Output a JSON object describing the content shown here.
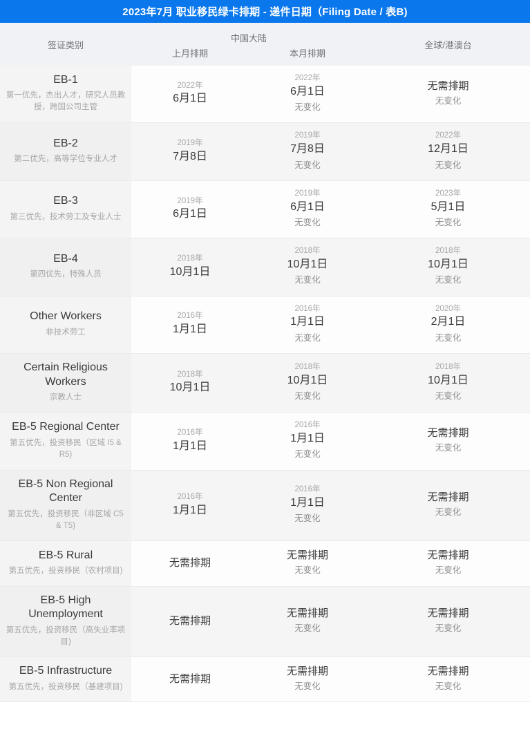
{
  "title": "2023年7月 职业移民绿卡排期 - 递件日期（Filing Date / 表B)",
  "accent_color": "#0a78ec",
  "header": {
    "category": "签证类别",
    "china_group": "中国大陆",
    "china_prev": "上月排期",
    "china_curr": "本月排期",
    "global": "全球/港澳台"
  },
  "labels": {
    "no_change": "无变化",
    "current": "无需排期"
  },
  "rows": [
    {
      "category": "EB-1",
      "description": "第一优先，杰出人才，研究人员教授，跨国公司主管",
      "china_prev": {
        "year": "2022年",
        "date": "6月1日",
        "note": ""
      },
      "china_curr": {
        "year": "2022年",
        "date": "6月1日",
        "note": "无变化"
      },
      "global": {
        "year": "",
        "date": "无需排期",
        "note": "无变化"
      }
    },
    {
      "category": "EB-2",
      "description": "第二优先，高等学位专业人才",
      "china_prev": {
        "year": "2019年",
        "date": "7月8日",
        "note": ""
      },
      "china_curr": {
        "year": "2019年",
        "date": "7月8日",
        "note": "无变化"
      },
      "global": {
        "year": "2022年",
        "date": "12月1日",
        "note": "无变化"
      }
    },
    {
      "category": "EB-3",
      "description": "第三优先，技术劳工及专业人士",
      "china_prev": {
        "year": "2019年",
        "date": "6月1日",
        "note": ""
      },
      "china_curr": {
        "year": "2019年",
        "date": "6月1日",
        "note": "无变化"
      },
      "global": {
        "year": "2023年",
        "date": "5月1日",
        "note": "无变化"
      }
    },
    {
      "category": "EB-4",
      "description": "第四优先，特殊人员",
      "china_prev": {
        "year": "2018年",
        "date": "10月1日",
        "note": ""
      },
      "china_curr": {
        "year": "2018年",
        "date": "10月1日",
        "note": "无变化"
      },
      "global": {
        "year": "2018年",
        "date": "10月1日",
        "note": "无变化"
      }
    },
    {
      "category": "Other Workers",
      "description": "非技术劳工",
      "china_prev": {
        "year": "2016年",
        "date": "1月1日",
        "note": ""
      },
      "china_curr": {
        "year": "2016年",
        "date": "1月1日",
        "note": "无变化"
      },
      "global": {
        "year": "2020年",
        "date": "2月1日",
        "note": "无变化"
      }
    },
    {
      "category": "Certain Religious Workers",
      "description": "宗教人士",
      "china_prev": {
        "year": "2018年",
        "date": "10月1日",
        "note": ""
      },
      "china_curr": {
        "year": "2018年",
        "date": "10月1日",
        "note": "无变化"
      },
      "global": {
        "year": "2018年",
        "date": "10月1日",
        "note": "无变化"
      }
    },
    {
      "category": "EB-5 Regional Center",
      "description": "第五优先，投资移民（区域 I5 & R5)",
      "china_prev": {
        "year": "2016年",
        "date": "1月1日",
        "note": ""
      },
      "china_curr": {
        "year": "2016年",
        "date": "1月1日",
        "note": "无变化"
      },
      "global": {
        "year": "",
        "date": "无需排期",
        "note": "无变化"
      }
    },
    {
      "category": "EB-5 Non Regional Center",
      "description": "第五优先，投资移民（非区域 C5 & T5)",
      "china_prev": {
        "year": "2016年",
        "date": "1月1日",
        "note": ""
      },
      "china_curr": {
        "year": "2016年",
        "date": "1月1日",
        "note": "无变化"
      },
      "global": {
        "year": "",
        "date": "无需排期",
        "note": "无变化"
      }
    },
    {
      "category": "EB-5 Rural",
      "description": "第五优先，投资移民（农村项目)",
      "china_prev": {
        "year": "",
        "date": "无需排期",
        "note": ""
      },
      "china_curr": {
        "year": "",
        "date": "无需排期",
        "note": "无变化"
      },
      "global": {
        "year": "",
        "date": "无需排期",
        "note": "无变化"
      }
    },
    {
      "category": "EB-5 High Unemployment",
      "description": "第五优先，投资移民（高失业率项目)",
      "china_prev": {
        "year": "",
        "date": "无需排期",
        "note": ""
      },
      "china_curr": {
        "year": "",
        "date": "无需排期",
        "note": "无变化"
      },
      "global": {
        "year": "",
        "date": "无需排期",
        "note": "无变化"
      }
    },
    {
      "category": "EB-5 Infrastructure",
      "description": "第五优先，投资移民（基建项目)",
      "china_prev": {
        "year": "",
        "date": "无需排期",
        "note": ""
      },
      "china_curr": {
        "year": "",
        "date": "无需排期",
        "note": "无变化"
      },
      "global": {
        "year": "",
        "date": "无需排期",
        "note": "无变化"
      }
    }
  ]
}
